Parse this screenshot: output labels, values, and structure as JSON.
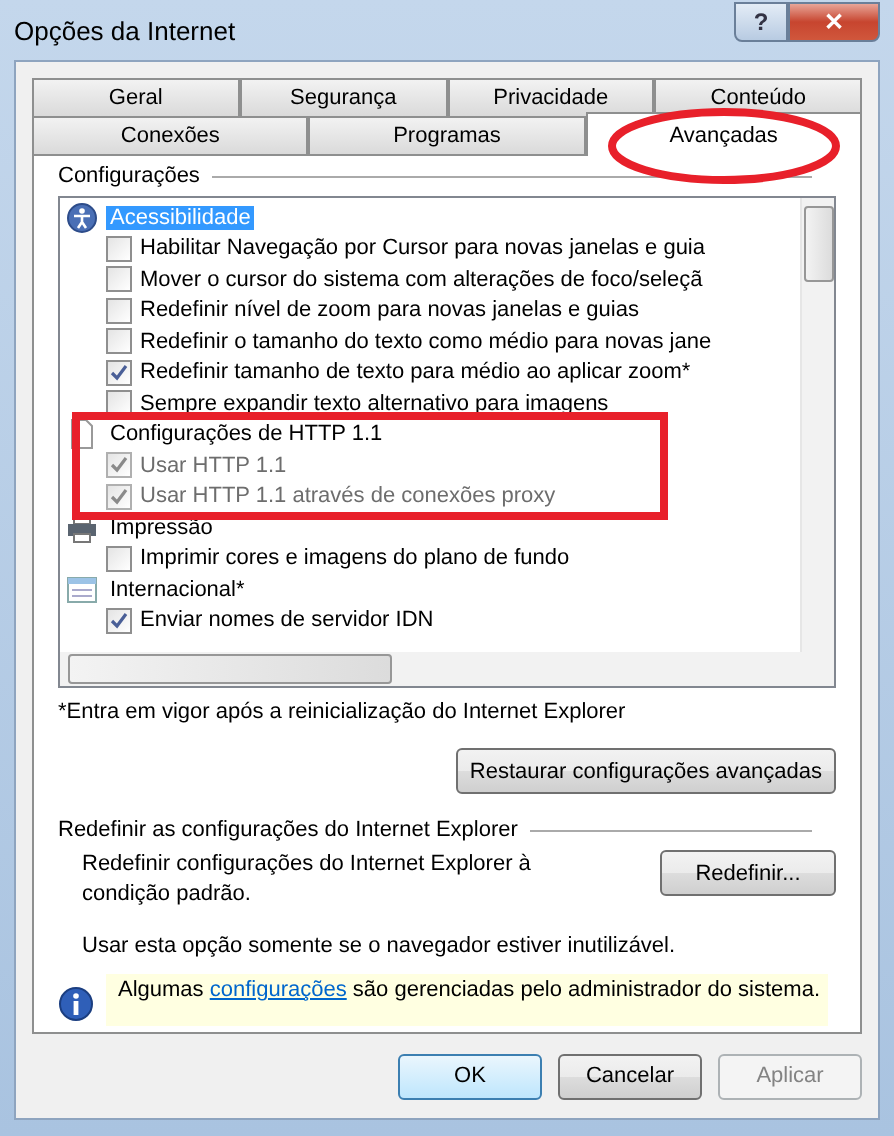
{
  "window": {
    "title": "Opções da Internet",
    "help_button": "?",
    "close_button": "✕"
  },
  "tabs": [
    [
      {
        "label": "Geral",
        "selected": false
      },
      {
        "label": "Segurança",
        "selected": false
      },
      {
        "label": "Privacidade",
        "selected": false
      },
      {
        "label": "Conteúdo",
        "selected": false
      }
    ],
    [
      {
        "label": "Conexões",
        "selected": false
      },
      {
        "label": "Programas",
        "selected": false
      },
      {
        "label": "Avançadas",
        "selected": true
      }
    ]
  ],
  "settings": {
    "title": "Configurações",
    "categories": [
      {
        "kind": "accessibility",
        "label": "Acessibilidade",
        "selected": true,
        "items": [
          {
            "label": "Habilitar Navegação por Cursor para novas janelas e guia",
            "checked": false,
            "disabled": false
          },
          {
            "label": "Mover o cursor do sistema com alterações de foco/seleçã",
            "checked": false,
            "disabled": false
          },
          {
            "label": "Redefinir nível de zoom para novas janelas e guias",
            "checked": false,
            "disabled": false
          },
          {
            "label": "Redefinir o tamanho do texto como médio para novas jane",
            "checked": false,
            "disabled": false
          },
          {
            "label": "Redefinir tamanho de texto para médio ao aplicar zoom*",
            "checked": true,
            "disabled": false
          },
          {
            "label": "Sempre expandir texto alternativo para imagens",
            "checked": false,
            "disabled": false
          }
        ]
      },
      {
        "kind": "page",
        "label": "Configurações de HTTP 1.1",
        "selected": false,
        "items": [
          {
            "label": "Usar HTTP 1.1",
            "checked": true,
            "disabled": true
          },
          {
            "label": "Usar HTTP 1.1 através de conexões proxy",
            "checked": true,
            "disabled": true
          }
        ]
      },
      {
        "kind": "printer",
        "label": "Impressão",
        "selected": false,
        "items": [
          {
            "label": "Imprimir cores e imagens do plano de fundo",
            "checked": false,
            "disabled": false
          }
        ]
      },
      {
        "kind": "international",
        "label": "Internacional*",
        "selected": false,
        "items": [
          {
            "label": "Enviar nomes de servidor IDN",
            "checked": true,
            "disabled": false
          }
        ]
      }
    ],
    "note": "*Entra em vigor após a reinicialização do Internet Explorer",
    "restore_button": "Restaurar configurações avançadas"
  },
  "reset": {
    "title": "Redefinir as configurações do Internet Explorer",
    "description": "Redefinir configurações do Internet Explorer à condição padrão.",
    "button": "Redefinir...",
    "warning": "Usar esta opção somente se o navegador estiver inutilizável."
  },
  "info_bar": {
    "before": "Algumas",
    "link": "configurações",
    "after": "são gerenciadas pelo administrador do sistema."
  },
  "buttons": [
    {
      "label": "OK",
      "disabled": false,
      "default": true
    },
    {
      "label": "Cancelar",
      "disabled": false,
      "default": false
    },
    {
      "label": "Aplicar",
      "disabled": true,
      "default": false
    }
  ]
}
